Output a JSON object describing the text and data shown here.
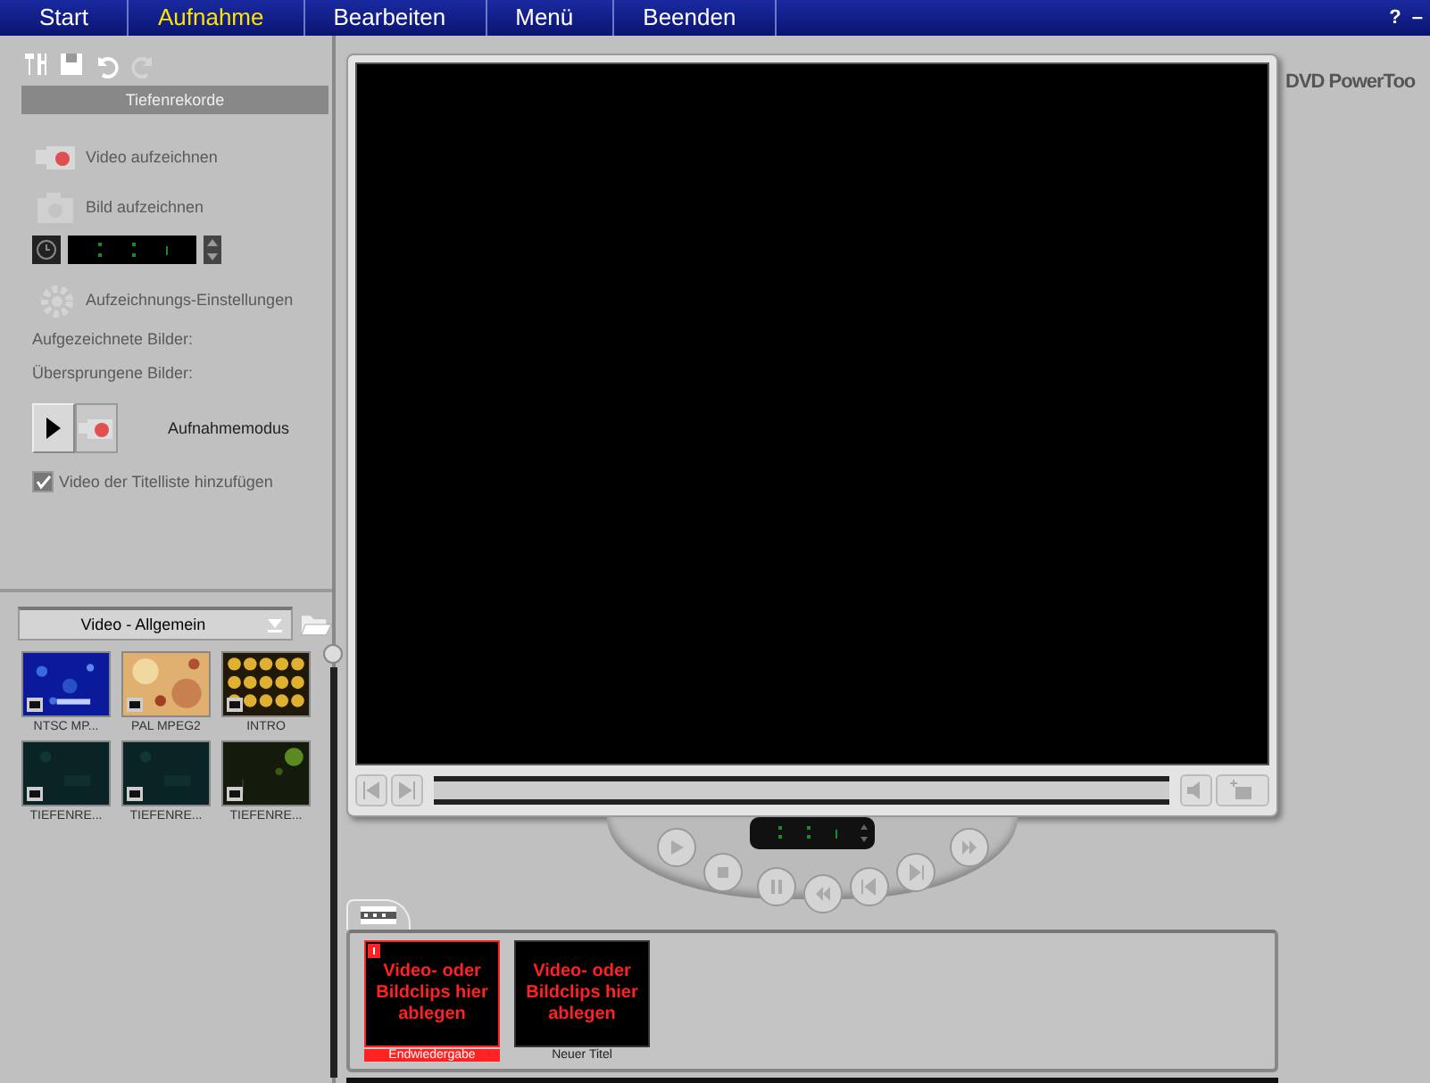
{
  "nav": {
    "items": [
      {
        "label": "Start",
        "selected": false
      },
      {
        "label": "Aufnahme",
        "selected": true
      },
      {
        "label": "Bearbeiten",
        "selected": false
      },
      {
        "label": "Menü",
        "selected": false
      },
      {
        "label": "Beenden",
        "selected": false
      }
    ],
    "window_buttons": [
      "?",
      "–"
    ]
  },
  "capture": {
    "title": "Tiefenrekorde",
    "video_button": "Video aufzeichnen",
    "image_button": "Bild aufzeichnen",
    "settings_button": "Aufzeichnungs-Einstellungen",
    "captured_label": "Aufgezeichnete Bilder:",
    "skipped_label": "Übersprungene Bilder:",
    "mode_label": "Aufnahmemodus",
    "add_to_titles": {
      "label": "Video der Titelliste hinzufügen",
      "checked": true
    }
  },
  "library": {
    "dropdown": "Video - Allgemein",
    "clips": [
      {
        "name": "NTSC MP..."
      },
      {
        "name": "PAL MPEG2"
      },
      {
        "name": "INTRO"
      },
      {
        "name": "TIEFENRE..."
      },
      {
        "name": "TIEFENRE..."
      },
      {
        "name": "TIEFENRE..."
      }
    ]
  },
  "logo": "DVD PowerToo",
  "storyboard": {
    "slots": [
      {
        "text": "Video- oder Bildclips hier ablegen",
        "caption": "Endwiedergabe",
        "selected": true
      },
      {
        "text": "Video- oder Bildclips hier ablegen",
        "caption": "Neuer Titel",
        "selected": false
      }
    ]
  }
}
